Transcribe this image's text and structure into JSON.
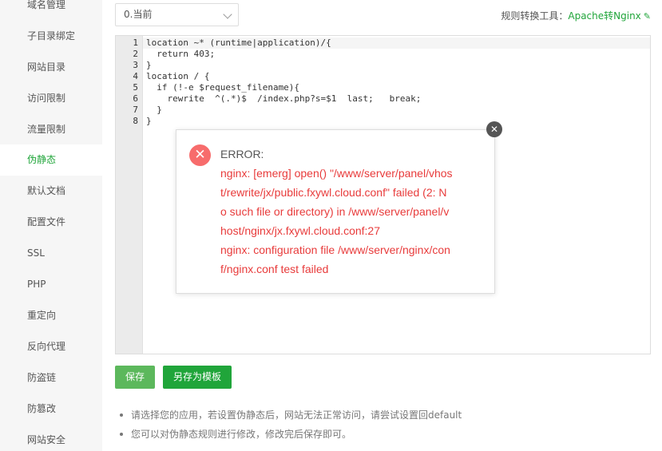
{
  "sidebar": {
    "items": [
      {
        "label": "域名管理",
        "active": false
      },
      {
        "label": "子目录绑定",
        "active": false
      },
      {
        "label": "网站目录",
        "active": false
      },
      {
        "label": "访问限制",
        "active": false
      },
      {
        "label": "流量限制",
        "active": false
      },
      {
        "label": "伪静态",
        "active": true
      },
      {
        "label": "默认文档",
        "active": false
      },
      {
        "label": "配置文件",
        "active": false
      },
      {
        "label": "SSL",
        "active": false
      },
      {
        "label": "PHP",
        "active": false
      },
      {
        "label": "重定向",
        "active": false
      },
      {
        "label": "反向代理",
        "active": false
      },
      {
        "label": "防盗链",
        "active": false
      },
      {
        "label": "防篡改",
        "active": false
      },
      {
        "label": "网站安全",
        "active": false
      }
    ]
  },
  "toolbar": {
    "version_select": "0.当前",
    "rule_tool_label": "规则转换工具：",
    "rule_tool_link": "Apache转Nginx"
  },
  "editor": {
    "line_numbers": [
      "1",
      "2",
      "3",
      "4",
      "5",
      "6",
      "7",
      "8"
    ],
    "lines": [
      "location ~* (runtime|application)/{",
      "  return 403;",
      "}",
      "location / {",
      "  if (!-e $request_filename){",
      "    rewrite  ^(.*)$  /index.php?s=$1  last;   break;",
      "  }",
      "}"
    ]
  },
  "dialog": {
    "title": "ERROR:",
    "message_lines": [
      "nginx: [emerg] open() \"/www/server/panel/vhos",
      "t/rewrite/jx/public.fxywl.cloud.conf\" failed (2: N",
      "o such file or directory) in /www/server/panel/v",
      "host/nginx/jx.fxywl.cloud.conf:27",
      "nginx: configuration file /www/server/nginx/con",
      "f/nginx.conf test failed"
    ]
  },
  "buttons": {
    "save": "保存",
    "save_as_template": "另存为模板"
  },
  "notes": [
    "请选择您的应用，若设置伪静态后，网站无法正常访问，请尝试设置回default",
    "您可以对伪静态规则进行修改，修改完后保存即可。"
  ],
  "colors": {
    "accent": "#20a53a",
    "save_button": "#5cb85c",
    "error_text": "#e83b3b",
    "error_icon": "#f76c6c"
  },
  "icons": {
    "dropdown": "chevron-down-icon",
    "link": "link-icon",
    "error": "error-circle-icon",
    "close": "close-circle-icon"
  }
}
